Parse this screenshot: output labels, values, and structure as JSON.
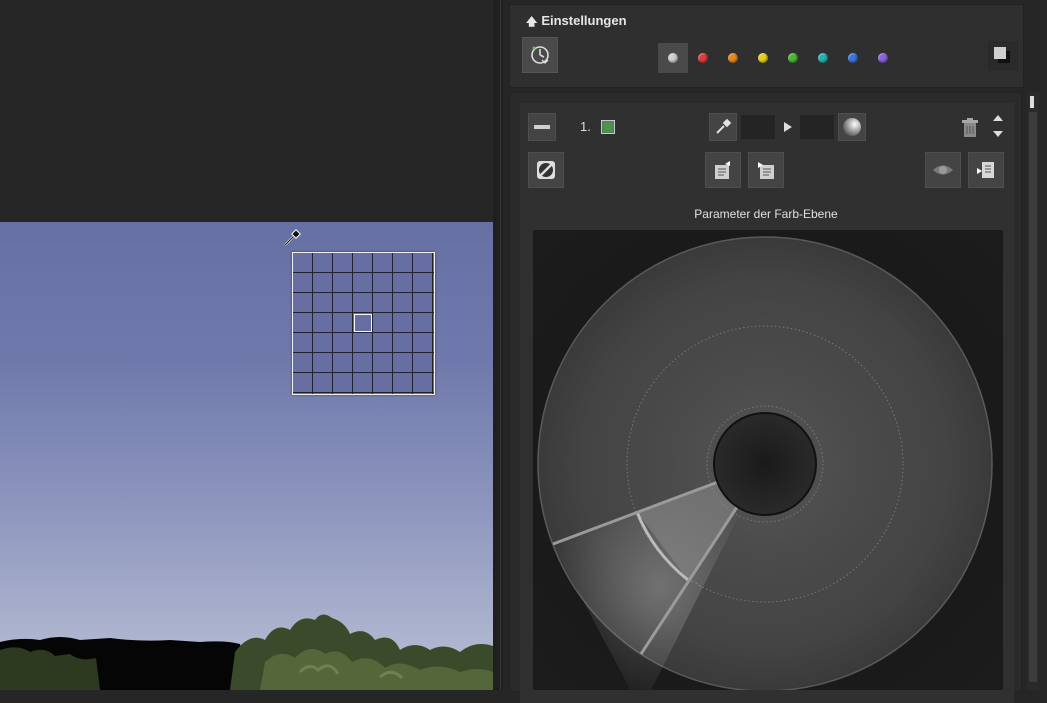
{
  "settings": {
    "title": "Einstellungen",
    "color_filters": [
      {
        "name": "gray",
        "color": "#d0d0d0",
        "active": true
      },
      {
        "name": "red",
        "color": "#e03b3b",
        "active": false
      },
      {
        "name": "orange",
        "color": "#e8861f",
        "active": false
      },
      {
        "name": "yellow",
        "color": "#e2d21d",
        "active": false
      },
      {
        "name": "green",
        "color": "#4ab72f",
        "active": false
      },
      {
        "name": "cyan",
        "color": "#1fb6b0",
        "active": false
      },
      {
        "name": "blue",
        "color": "#3a74e0",
        "active": false
      },
      {
        "name": "purple",
        "color": "#8a62e0",
        "active": false
      }
    ]
  },
  "layer": {
    "number": "1.",
    "title": "Parameter der Farb-Ebene"
  },
  "icons": {
    "preset": "preset-dial-icon",
    "window_mode": "window-mode-icon",
    "collapse": "minus-icon",
    "layer_color": "layer-color-swatch-icon",
    "pipette": "pipette-icon",
    "play": "play-arrow-icon",
    "sphere": "sphere-icon",
    "trash": "trash-icon",
    "arrow_up": "arrow-up-icon",
    "arrow_down": "arrow-down-icon",
    "invert": "invert-icon",
    "export": "export-icon",
    "import": "import-icon",
    "eye": "eye-icon",
    "new_doc": "new-document-icon"
  },
  "photo": {
    "sky_top": "#6670a3",
    "sky_bottom": "#b9bfd5",
    "loupe_grid": "7x7"
  }
}
